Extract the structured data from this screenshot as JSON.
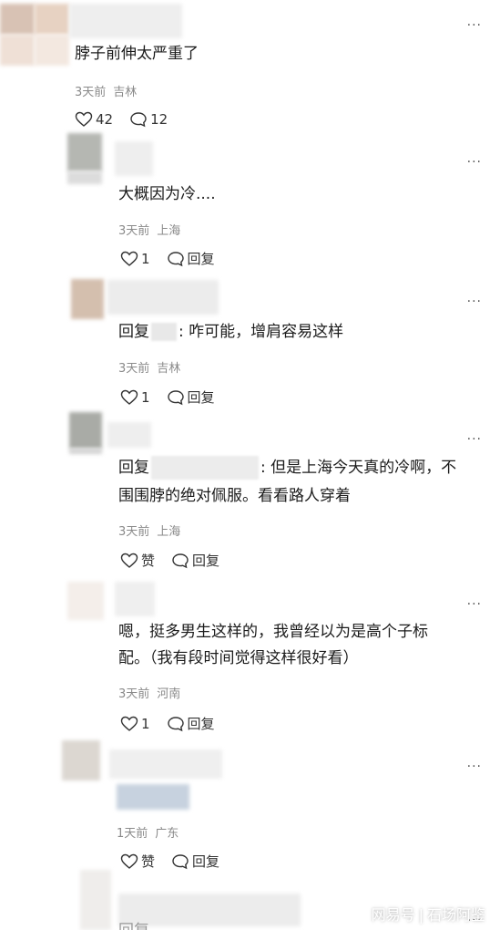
{
  "more_label": "···",
  "comments": [
    {
      "text": "脖子前伸太严重了",
      "time": "3天前",
      "location": "吉林",
      "like_count": "42",
      "reply_count": "12"
    },
    {
      "text": "大概因为冷....",
      "time": "3天前",
      "location": "上海",
      "like_count": "1",
      "reply_label": "回复"
    },
    {
      "prefix": "回复",
      "text": ": 咋可能，增肩容易这样",
      "time": "3天前",
      "location": "吉林",
      "like_count": "1",
      "reply_label": "回复"
    },
    {
      "prefix": "回复",
      "text_line1": ": 但是上海今天真的冷啊，不",
      "text_line2": "围围脖的绝对佩服。看看路人穿着",
      "time": "3天前",
      "location": "上海",
      "like_label": "赞",
      "reply_label": "回复"
    },
    {
      "text_line1": "嗯，挺多男生这样的，我曾经以为是高个子标",
      "text_line2": "配。（我有段时间觉得这样很好看）",
      "time": "3天前",
      "location": "河南",
      "like_count": "1",
      "reply_label": "回复"
    },
    {
      "time": "1天前",
      "location": "广东",
      "like_label": "赞",
      "reply_label": "回复"
    },
    {
      "prefix": "回复"
    }
  ],
  "watermark": {
    "brand": "网易号",
    "separator": "|",
    "author": "石场阿鉴"
  }
}
